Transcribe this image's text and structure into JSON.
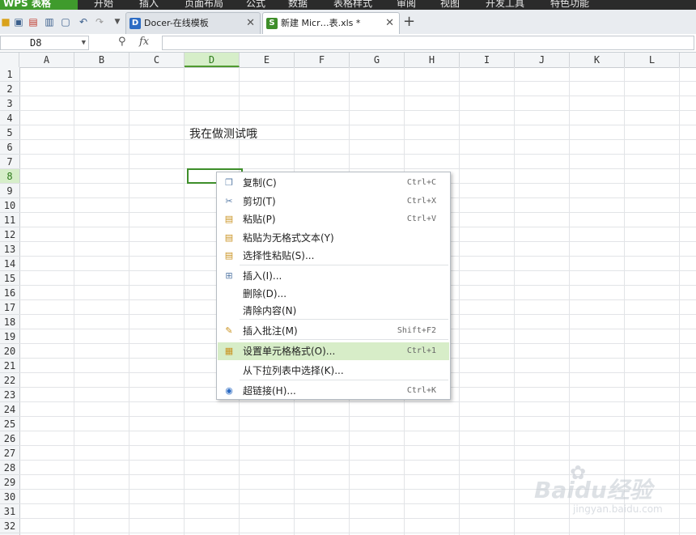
{
  "ribbon": {
    "app_button": "WPS 表格",
    "tabs": [
      "开始",
      "插入",
      "页面布局",
      "公式",
      "数据",
      "表格样式",
      "审阅",
      "视图",
      "开发工具",
      "特色功能"
    ]
  },
  "tabs": {
    "docer": {
      "label": "Docer-在线模板",
      "icon": "D"
    },
    "sheet": {
      "label": "新建 Micr…表.xls *",
      "icon": "S"
    },
    "close_glyph": "✕",
    "add_glyph": "+"
  },
  "formula_bar": {
    "cell_ref": "D8",
    "fx": "fx",
    "value": ""
  },
  "grid": {
    "columns": [
      "A",
      "B",
      "C",
      "D",
      "E",
      "F",
      "G",
      "H",
      "I",
      "J",
      "K",
      "L"
    ],
    "rows": [
      "1",
      "2",
      "3",
      "4",
      "5",
      "6",
      "7",
      "8",
      "9",
      "10",
      "11",
      "12",
      "13",
      "14",
      "15",
      "16",
      "17",
      "18",
      "19",
      "20",
      "21",
      "22",
      "23",
      "24",
      "25",
      "26",
      "27",
      "28",
      "29",
      "30",
      "31",
      "32"
    ],
    "active_column": "D",
    "active_row": "8",
    "cell_d5": "我在做测试哦"
  },
  "context_menu": {
    "items": [
      {
        "label": "复制(C)",
        "shortcut": "Ctrl+C",
        "icon": "copy-icon"
      },
      {
        "label": "剪切(T)",
        "shortcut": "Ctrl+X",
        "icon": "cut-icon"
      },
      {
        "label": "粘贴(P)",
        "shortcut": "Ctrl+V",
        "icon": "paste-icon"
      },
      {
        "label": "粘贴为无格式文本(Y)",
        "shortcut": "",
        "icon": "paste-text-icon"
      },
      {
        "label": "选择性粘贴(S)...",
        "shortcut": "",
        "icon": "paste-special-icon"
      },
      {
        "label": "插入(I)...",
        "shortcut": "",
        "icon": "insert-icon"
      },
      {
        "label": "删除(D)...",
        "shortcut": "",
        "icon": ""
      },
      {
        "label": "清除内容(N)",
        "shortcut": "",
        "icon": ""
      },
      {
        "label": "插入批注(M)",
        "shortcut": "Shift+F2",
        "icon": "comment-icon"
      },
      {
        "label": "设置单元格格式(O)...",
        "shortcut": "Ctrl+1",
        "icon": "format-cells-icon"
      },
      {
        "label": "从下拉列表中选择(K)...",
        "shortcut": "",
        "icon": ""
      },
      {
        "label": "超链接(H)...",
        "shortcut": "Ctrl+K",
        "icon": "hyperlink-icon"
      }
    ]
  },
  "watermark": {
    "text": "Baidu经验",
    "sub": "jingyan.baidu.com"
  },
  "colors": {
    "accent_green": "#3e8e2a",
    "highlight": "#d7edc8",
    "ribbon_bg": "#2b2b2b"
  }
}
